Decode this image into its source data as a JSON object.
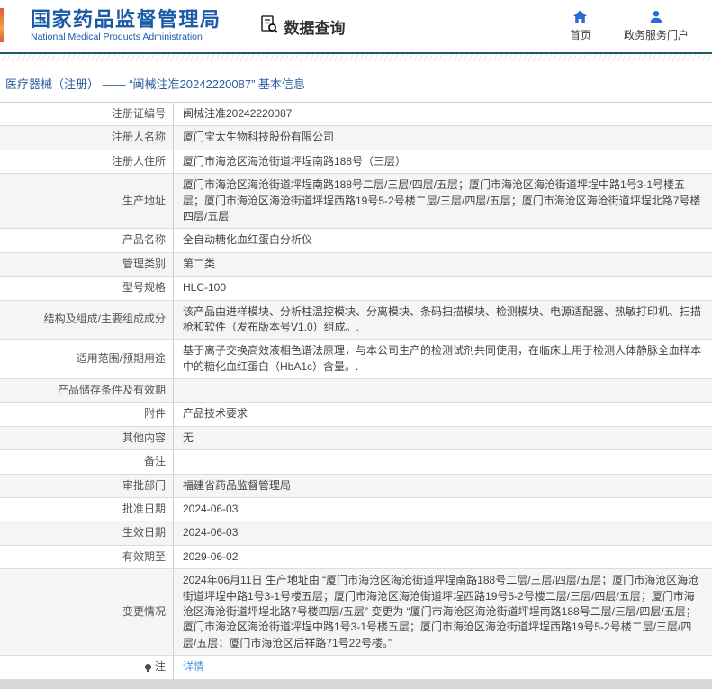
{
  "colors": {
    "brand_blue": "#1a5aa6",
    "teal_line": "#1f5a6e",
    "link_blue": "#4a90d9",
    "emblem_orange": "#efa33d",
    "row_alt_gray": "#f5f5f5"
  },
  "header": {
    "agency_cn": "国家药品监督管理局",
    "agency_en": "National Medical Products Administration",
    "data_query_label": "数据查询",
    "nav": {
      "home_label": "首页",
      "portal_label": "政务服务门户"
    }
  },
  "breadcrumb": {
    "text": "医疗器械（注册） ——  “闽械注准20242220087” 基本信息"
  },
  "table": {
    "rows": [
      {
        "label": "注册证编号",
        "value": "闽械注准20242220087"
      },
      {
        "label": "注册人名称",
        "value": "厦门宝太生物科技股份有限公司"
      },
      {
        "label": "注册人住所",
        "value": "厦门市海沧区海沧街道坪埕南路188号（三层）"
      },
      {
        "label": "生产地址",
        "value": "厦门市海沧区海沧街道坪埕南路188号二层/三层/四层/五层；厦门市海沧区海沧街道坪埕中路1号3-1号楼五层；厦门市海沧区海沧街道坪埕西路19号5-2号楼二层/三层/四层/五层；厦门市海沧区海沧街道坪埕北路7号楼四层/五层"
      },
      {
        "label": "产品名称",
        "value": "全自动糖化血红蛋白分析仪"
      },
      {
        "label": "管理类别",
        "value": "第二类"
      },
      {
        "label": "型号规格",
        "value": "HLC-100"
      },
      {
        "label": "结构及组成/主要组成成分",
        "value": "该产品由进样模块、分析柱温控模块、分离模块、条码扫描模块、检测模块、电源适配器、热敏打印机、扫描枪和软件（发布版本号V1.0）组成。."
      },
      {
        "label": "适用范围/预期用途",
        "value": "基于离子交换高效液相色谱法原理，与本公司生产的检测试剂共同使用，在临床上用于检测人体静脉全血样本中的糖化血红蛋白（HbA1c）含量。."
      },
      {
        "label": "产品储存条件及有效期",
        "value": ""
      },
      {
        "label": "附件",
        "value": "产品技术要求"
      },
      {
        "label": "其他内容",
        "value": "无"
      },
      {
        "label": "备注",
        "value": ""
      },
      {
        "label": "审批部门",
        "value": "福建省药品监督管理局"
      },
      {
        "label": "批准日期",
        "value": "2024-06-03"
      },
      {
        "label": "生效日期",
        "value": "2024-06-03"
      },
      {
        "label": "有效期至",
        "value": "2029-06-02"
      },
      {
        "label": "变更情况",
        "value": "2024年06月11日 生产地址由 “厦门市海沧区海沧街道坪埕南路188号二层/三层/四层/五层；厦门市海沧区海沧街道坪埕中路1号3-1号楼五层；厦门市海沧区海沧街道坪埕西路19号5-2号楼二层/三层/四层/五层；厦门市海沧区海沧街道坪埕北路7号楼四层/五层” 变更为 “厦门市海沧区海沧街道坪埕南路188号二层/三层/四层/五层；厦门市海沧区海沧街道坪埕中路1号3-1号楼五层；厦门市海沧区海沧街道坪埕西路19号5-2号楼二层/三层/四层/五层；厦门市海沧区后祥路71号22号楼。”"
      },
      {
        "label": "注",
        "value": "详情",
        "icon": "bulb-icon",
        "link": true
      }
    ]
  }
}
